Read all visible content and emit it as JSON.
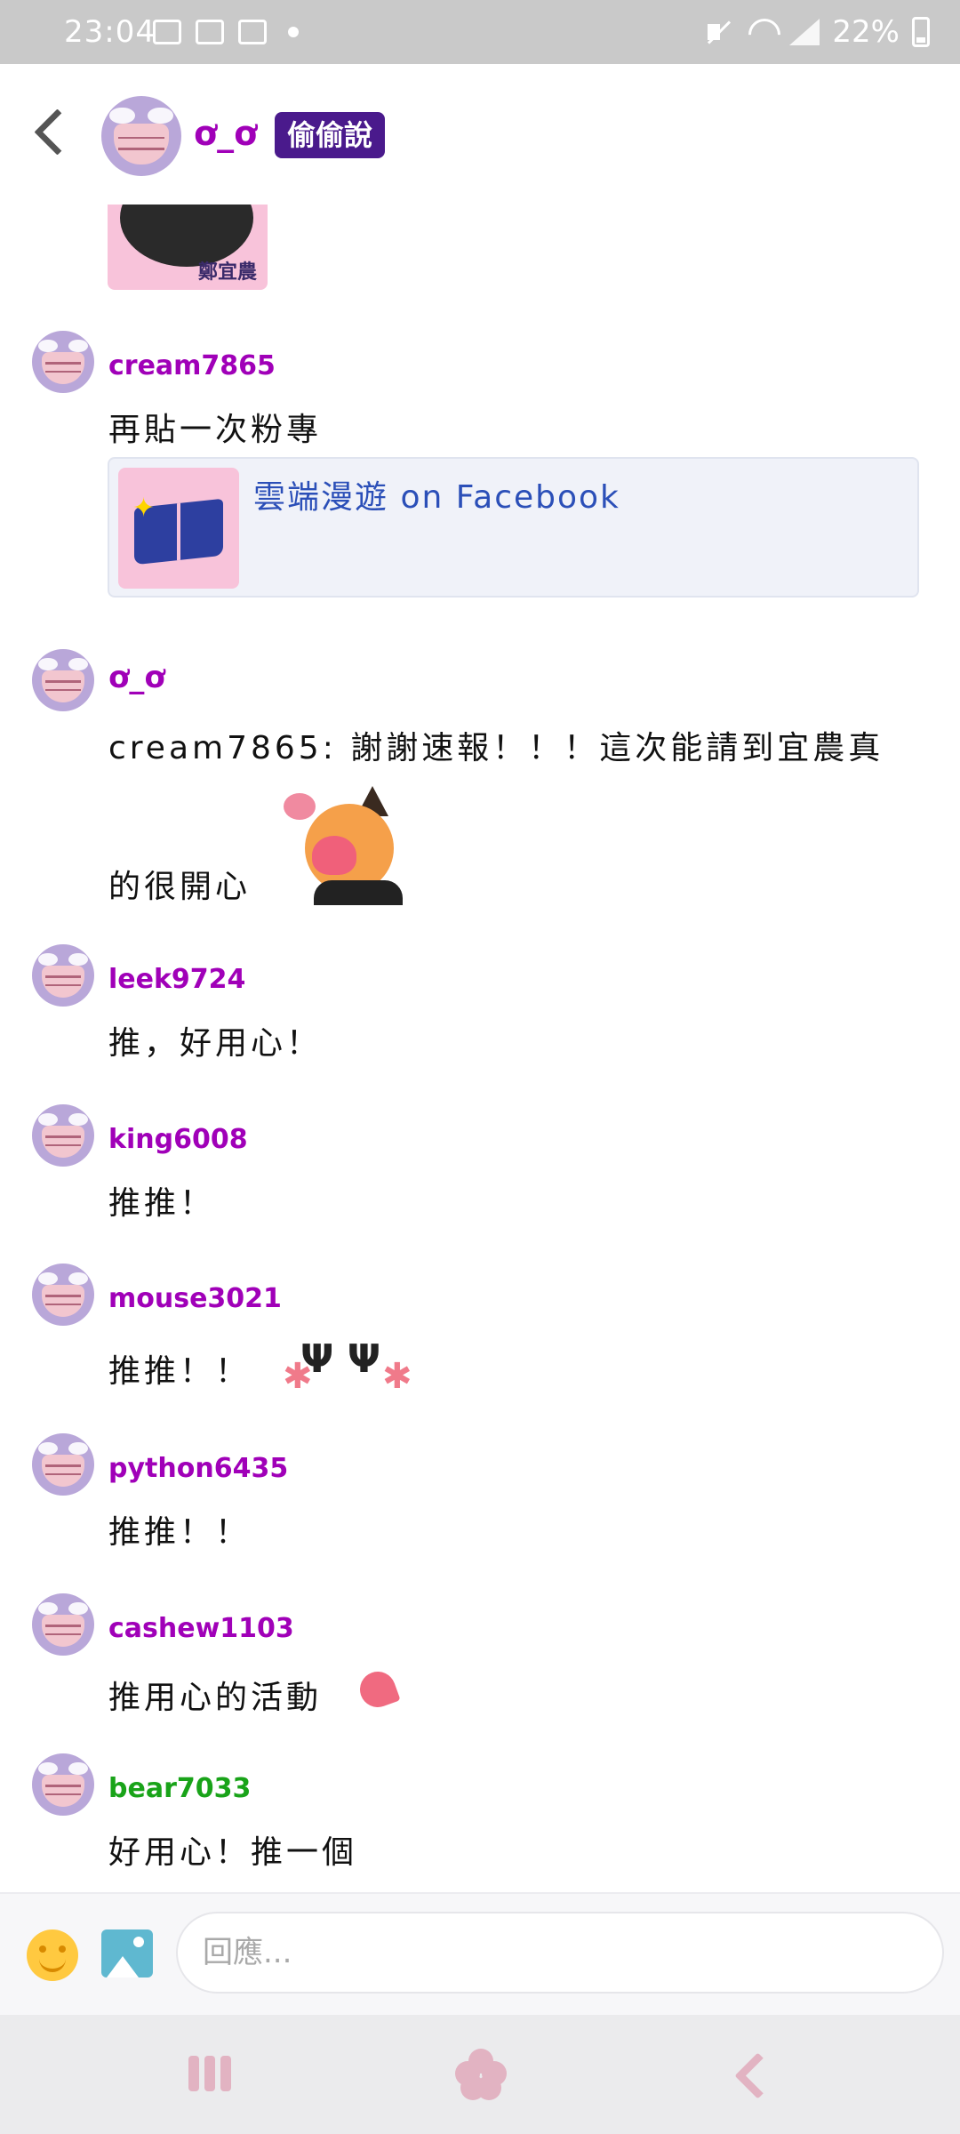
{
  "status_bar": {
    "time": "23:04",
    "battery": "22%",
    "icons": [
      "gmail-icon",
      "gallery-icon",
      "media-icon",
      "notification-dot",
      "mute-icon",
      "wifi-icon",
      "signal-icon",
      "battery-icon"
    ]
  },
  "header": {
    "name": "ơ_ơ",
    "badge": "偷偷說"
  },
  "top_image_caption": "鄭宜農",
  "messages": [
    {
      "user": "cream7865",
      "text": "再貼一次粉專"
    },
    {
      "user": "ơ_ơ",
      "text_line1": "cream7865: 謝謝速報！！！這次能請到宜農真",
      "text_line2": "的很開心"
    },
    {
      "user": "leek9724",
      "text": "推，好用心！"
    },
    {
      "user": "king6008",
      "text": "推推！"
    },
    {
      "user": "mouse3021",
      "text": "推推！！"
    },
    {
      "user": "python6435",
      "text": "推推！！"
    },
    {
      "user": "cashew1103",
      "text": "推用心的活動"
    },
    {
      "user": "bear7033",
      "text": "好用心！推一個"
    }
  ],
  "link_card": {
    "title": "雲端漫遊 on Facebook"
  },
  "input": {
    "placeholder": "回應..."
  },
  "colors": {
    "username": "#a000b8",
    "username_green": "#19a319",
    "badge": "#4a1a8c",
    "link": "#2b4fb8",
    "status_bar": "#c9c9c9"
  }
}
